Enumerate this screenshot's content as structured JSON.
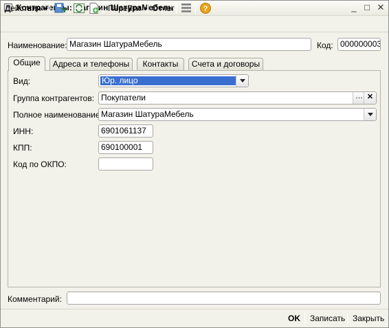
{
  "window": {
    "title": "Контрагенты: Магазин ШатураМебель",
    "minimize": "_",
    "maximize": "□",
    "close": "✕"
  },
  "toolbar": {
    "actions": "Действия",
    "goto": "Перейти",
    "report": "Отчет",
    "help": "?"
  },
  "header": {
    "name_label": "Наименование:",
    "name_value": "Магазин ШатураМебель",
    "code_label": "Код:",
    "code_value": "000000003"
  },
  "tabs": [
    {
      "label": "Общие"
    },
    {
      "label": "Адреса и телефоны"
    },
    {
      "label": "Контакты"
    },
    {
      "label": "Счета и договоры"
    }
  ],
  "general": {
    "type_label": "Вид:",
    "type_value": "Юр. лицо",
    "group_label": "Группа контрагентов:",
    "group_value": "Покупатели",
    "fullname_label": "Полное наименование:",
    "fullname_value": "Магазин ШатураМебель",
    "inn_label": "ИНН:",
    "inn_value": "6901061137",
    "kpp_label": "КПП:",
    "kpp_value": "690100001",
    "okpo_label": "Код по ОКПО:",
    "okpo_value": ""
  },
  "comment": {
    "label": "Комментарий:",
    "value": ""
  },
  "footer": {
    "ok": "OK",
    "save": "Записать",
    "close": "Закрыть"
  },
  "colors": {
    "selection": "#3a6fd1",
    "background": "#f3f2ea",
    "help_icon": "#e8a21a"
  }
}
